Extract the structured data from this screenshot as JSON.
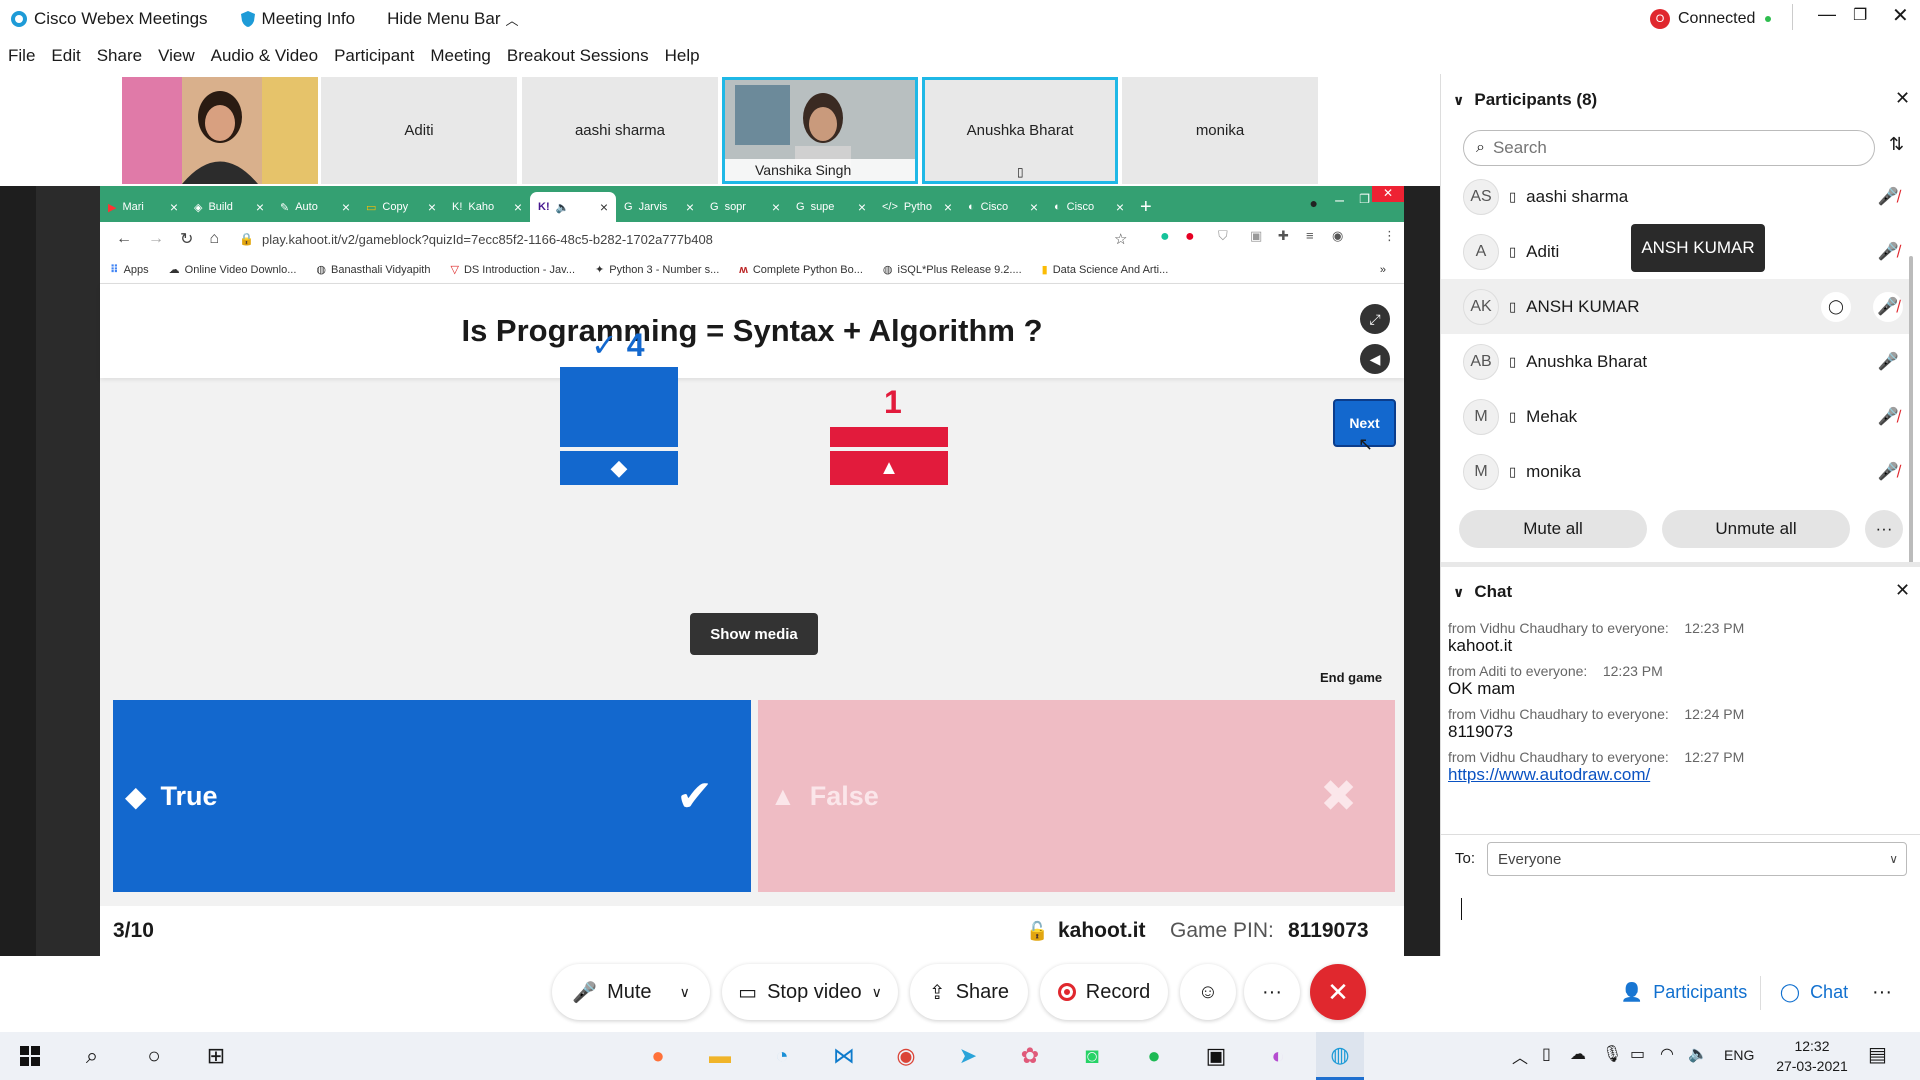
{
  "titlebar": {
    "app_title": "Cisco Webex Meetings",
    "meeting_info": "Meeting Info",
    "hide_menu": "Hide Menu Bar",
    "connected": "Connected",
    "conn_badge": "O"
  },
  "menu": [
    "File",
    "Edit",
    "Share",
    "View",
    "Audio & Video",
    "Participant",
    "Meeting",
    "Breakout Sessions",
    "Help"
  ],
  "video_strip": [
    {
      "name": "",
      "video": true
    },
    {
      "name": "Aditi"
    },
    {
      "name": "aashi sharma"
    },
    {
      "name": "Vanshika Singh",
      "video": true
    },
    {
      "name": "Anushka Bharat",
      "selected": true
    },
    {
      "name": "monika"
    }
  ],
  "browser": {
    "tabs": [
      "Mari",
      "Build",
      "Auto",
      "Copy",
      "Kaho",
      "",
      "Jarvis",
      "sopr",
      "supe",
      "Pytho",
      "Cisco",
      "Cisco"
    ],
    "url": "play.kahoot.it/v2/gameblock?quizId=7ecc85f2-1166-48c5-b282-1702a777b408",
    "bookmarks": [
      "Apps",
      "Online Video Downlo...",
      "Banasthali Vidyapith",
      "DS Introduction - Jav...",
      "Python 3 - Number s...",
      "Complete Python Bo...",
      "iSQL*Plus Release 9.2....",
      "Data Science And Arti..."
    ]
  },
  "kahoot": {
    "question": "Is Programming = Syntax + Algorithm ?",
    "next": "Next",
    "show_media": "Show media",
    "end_game": "End game",
    "results": [
      {
        "label": "True",
        "count": 4,
        "correct": true,
        "color": "#1368ce"
      },
      {
        "label": "False",
        "count": 1,
        "correct": false,
        "color": "#e21b3c"
      }
    ],
    "true_count_text": "4",
    "false_count_text": "1",
    "answer_true": "True",
    "answer_false": "False",
    "progress": "3/10",
    "site": "kahoot.it",
    "pin_label": "Game PIN:",
    "pin": "8119073"
  },
  "participants": {
    "title": "Participants (8)",
    "search_placeholder": "Search",
    "tooltip": "ANSH KUMAR",
    "list": [
      {
        "initials": "AS",
        "name": "aashi sharma",
        "muted": true
      },
      {
        "initials": "A",
        "name": "Aditi",
        "muted": true
      },
      {
        "initials": "AK",
        "name": "ANSH KUMAR",
        "muted": true,
        "highlight": true
      },
      {
        "initials": "AB",
        "name": "Anushka Bharat",
        "muted": false
      },
      {
        "initials": "M",
        "name": "Mehak",
        "muted": true
      },
      {
        "initials": "M",
        "name": "monika",
        "muted": true
      }
    ],
    "mute_all": "Mute all",
    "unmute_all": "Unmute all"
  },
  "chat": {
    "title": "Chat",
    "messages": [
      {
        "from": "from Vidhu Chaudhary to everyone:",
        "time": "12:23 PM",
        "text": "kahoot.it"
      },
      {
        "from": "from Aditi to everyone:",
        "time": "12:23 PM",
        "text": "OK mam"
      },
      {
        "from": "from Vidhu Chaudhary to everyone:",
        "time": "12:24 PM",
        "text": "8119073"
      },
      {
        "from": "from Vidhu Chaudhary to everyone:",
        "time": "12:27 PM",
        "text": "https://www.autodraw.com/",
        "link": true
      }
    ],
    "to_label": "To:",
    "to_value": "Everyone"
  },
  "controls": {
    "mute": "Mute",
    "stop_video": "Stop video",
    "share": "Share",
    "record": "Record",
    "participants": "Participants",
    "chat": "Chat"
  },
  "taskbar": {
    "lang": "ENG",
    "time": "12:32",
    "date": "27-03-2021"
  },
  "colors": {
    "kahoot_blue": "#1368ce",
    "kahoot_red": "#e21b3c",
    "webex_end": "#e0282e",
    "chrome_green": "#34a072"
  }
}
